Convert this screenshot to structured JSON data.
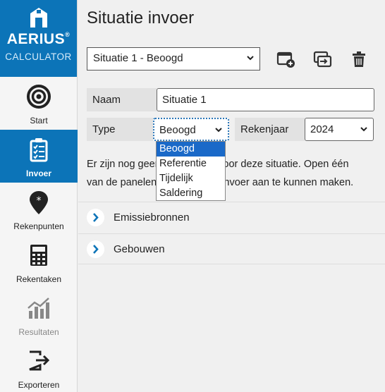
{
  "brand": {
    "name": "AERIUS",
    "mark": "®",
    "product": "CALCULATOR"
  },
  "nav": [
    {
      "label": "Start",
      "icon": "target-icon",
      "state": "normal"
    },
    {
      "label": "Invoer",
      "icon": "clipboard-checklist-icon",
      "state": "active"
    },
    {
      "label": "Rekenpunten",
      "icon": "map-pin-star-icon",
      "state": "normal"
    },
    {
      "label": "Rekentaken",
      "icon": "calculator-icon",
      "state": "normal"
    },
    {
      "label": "Resultaten",
      "icon": "chart-growth-icon",
      "state": "disabled"
    },
    {
      "label": "Exporteren",
      "icon": "export-icon",
      "state": "normal"
    }
  ],
  "page": {
    "title": "Situatie invoer"
  },
  "situation_select": {
    "value": "Situatie 1 - Beoogd"
  },
  "toolbar": {
    "add_icon": "add-situation-icon",
    "copy_icon": "copy-situation-icon",
    "delete_icon": "trash-icon"
  },
  "form": {
    "name_label": "Naam",
    "name_value": "Situatie 1",
    "type_label": "Type",
    "type_value": "Beoogd",
    "year_label": "Rekenjaar",
    "year_value": "2024"
  },
  "info": {
    "line1_pre": "Er zijn nog geen",
    "line1_post": "ns voor deze situatie. Open één",
    "line2_pre": "van de panelen",
    "line2_post": "invoer aan te kunnen maken."
  },
  "type_options": [
    "Beoogd",
    "Referentie",
    "Tijdelijk",
    "Saldering"
  ],
  "panels": [
    {
      "label": "Emissiebronnen"
    },
    {
      "label": "Gebouwen"
    }
  ],
  "colors": {
    "brand_blue": "#0c74b8",
    "selected_option": "#1a69c8"
  }
}
